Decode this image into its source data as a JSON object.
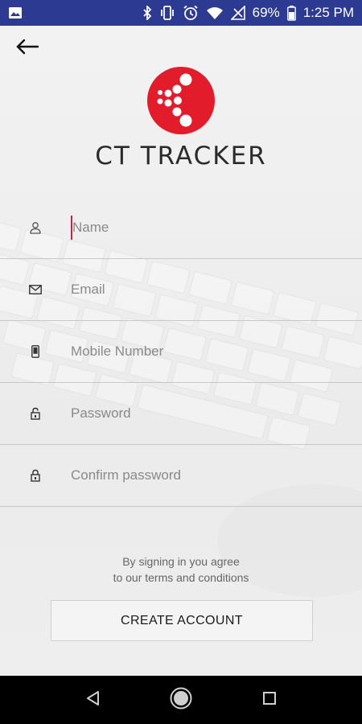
{
  "status_bar": {
    "battery": "69%",
    "time": "1:25 PM",
    "icons": [
      "image-icon",
      "bluetooth-icon",
      "vibrate-icon",
      "alarm-icon",
      "wifi-icon",
      "signal-icon",
      "battery-icon"
    ]
  },
  "header": {
    "back_icon": "arrow-left-icon",
    "app_name": "CT TRACKER",
    "logo_color": "#e31c2b"
  },
  "form": {
    "fields": [
      {
        "icon": "person-icon",
        "placeholder": "Name"
      },
      {
        "icon": "mail-icon",
        "placeholder": "Email"
      },
      {
        "icon": "phone-icon",
        "placeholder": "Mobile Number"
      },
      {
        "icon": "lock-icon",
        "placeholder": "Password"
      },
      {
        "icon": "lock-icon",
        "placeholder": "Confirm password"
      }
    ]
  },
  "terms": {
    "line1": "By signing in you agree",
    "line2": "to our terms and conditions"
  },
  "actions": {
    "create_account": "CREATE ACCOUNT"
  },
  "nav": {
    "back": "nav-back-icon",
    "home": "nav-home-icon",
    "recents": "nav-recents-icon"
  }
}
